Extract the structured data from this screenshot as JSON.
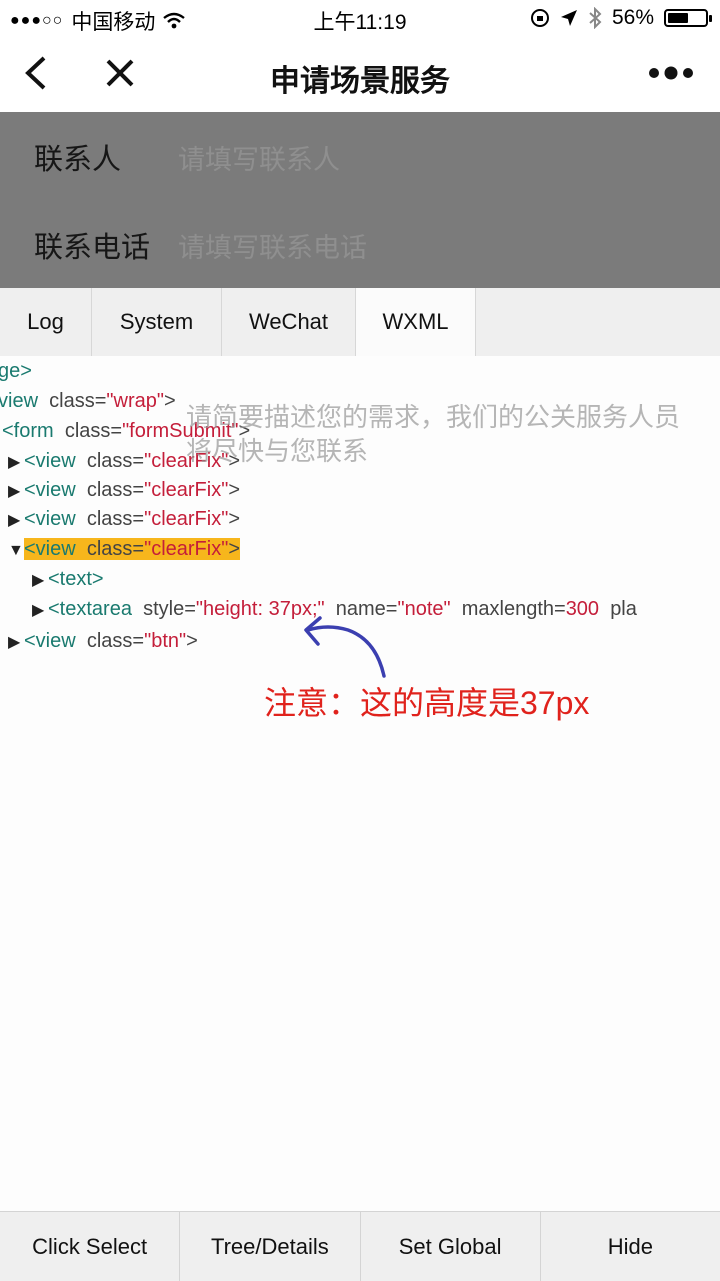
{
  "status": {
    "carrier": "中国移动",
    "time": "上午11:19",
    "battery": "56%",
    "battery_level": 0.56
  },
  "nav": {
    "title": "申请场景服务"
  },
  "form": {
    "contact_label": "联系人",
    "contact_placeholder": "请填写联系人",
    "phone_label": "联系电话",
    "phone_placeholder": "请填写联系电话"
  },
  "tabs": [
    "Log",
    "System",
    "WeChat",
    "WXML"
  ],
  "wxml": {
    "l1": "ge>",
    "l2_tag": "view",
    "l2_attr": "class",
    "l2_val": "\"wrap\"",
    "l3_tag": "<form",
    "l3_attr": "class",
    "l3_val": "\"formSubmit\"",
    "view_tag": "<view",
    "class_attr": "class",
    "clearfix_val": "\"clearFix\"",
    "text_tag": "<text>",
    "textarea_tag": "<textarea",
    "style_attr": "style",
    "style_val": "\"height: 37px;\"",
    "name_attr": "name",
    "name_val": "\"note\"",
    "maxlength_attr": "maxlength",
    "maxlength_val": "300",
    "pla": "pla",
    "btn_val": "\"btn\""
  },
  "overlay_placeholder": "请简要描述您的需求，我们的公关服务人员将尽快与您联系",
  "annotation": "注意：这的高度是37px",
  "toolbar": [
    "Click Select",
    "Tree/Details",
    "Set Global",
    "Hide"
  ],
  "colors": {
    "tag": "#1a7a6f",
    "value": "#c41e3a",
    "highlight": "#f7b61c",
    "annotation": "#e0221c",
    "arrow": "#3b3fb0"
  }
}
